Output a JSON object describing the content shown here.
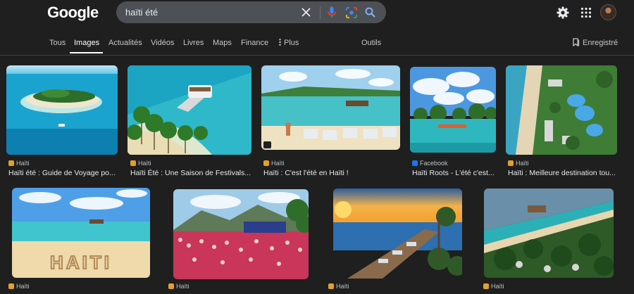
{
  "header": {
    "logo_text": "Google",
    "search_value": "haïti été",
    "icons": [
      "close-icon",
      "mic-icon",
      "lens-icon",
      "search-icon",
      "gear-icon",
      "apps-icon",
      "avatar"
    ]
  },
  "tabs": {
    "items": [
      "Tous",
      "Images",
      "Actualités",
      "Vidéos",
      "Livres",
      "Maps",
      "Finance",
      "Plus"
    ],
    "active": "Images",
    "tools_label": "Outils",
    "saved_label": "Enregistré"
  },
  "results": [
    {
      "source": "Haïti",
      "title": "Haïti été : Guide de Voyage po..."
    },
    {
      "source": "Haïti",
      "title": "Haïti Été : Une Saison de Festivals..."
    },
    {
      "source": "Haïti",
      "title": "Haïti : C'est l'été en Haïti !"
    },
    {
      "source": "Facebook",
      "title": "Haïti Roots - L'été c'est..."
    },
    {
      "source": "Haïti",
      "title": "Haïti : Meilleure destination tou..."
    },
    {
      "source": "Haïti",
      "title": "",
      "image_text": "HAITI"
    },
    {
      "source": "Haïti",
      "title": ""
    },
    {
      "source": "Haïti",
      "title": ""
    },
    {
      "source": "Haïti",
      "title": ""
    }
  ],
  "colors": {
    "background": "#1f1f1f",
    "searchbox": "#4d5156",
    "facebook": "#1877f2",
    "haiti_favicon": "#e3a02b"
  }
}
